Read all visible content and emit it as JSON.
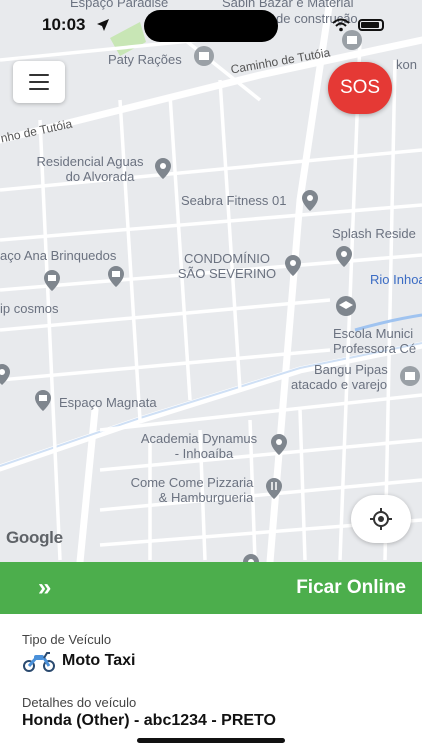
{
  "status_bar": {
    "time": "10:03"
  },
  "map": {
    "top_labels": {
      "espaco_paradise": "Espaço Paradise",
      "sabin_bazar": "Sabin Bazar e Material",
      "de_construcao": "de construção",
      "kon": "kon"
    },
    "streets": {
      "caminho_tutoia_top": "Caminho de Tutóia",
      "caminho_tutoia_left": "nho de Tutóia"
    },
    "pois": {
      "paty_racoes": "Paty Rações",
      "residencial_1": "Residencial Aguas",
      "residencial_2": "do Alvorada",
      "seabra": "Seabra Fitness 01",
      "splash": "Splash Reside",
      "ana_brinquedos": "aço Ana Brinquedos",
      "condominio_1": "CONDOMÍNIO",
      "condominio_2": "SÃO SEVERINO",
      "rio_inhoa": "Rio Inhoa",
      "ip_cosmos": "ip cosmos",
      "escola_1": "Escola Munici",
      "escola_2": "Professora Cé",
      "bangu_1": "Bangu Pipas",
      "bangu_2": "atacado e varejo",
      "espaco_magnata": "Espaço Magnata",
      "academia_1": "Academia Dynamus",
      "academia_2": "- Inhoaíba",
      "pizzaria_1": "Come Come Pizzaria",
      "pizzaria_2": "& Hamburgueria"
    },
    "google_logo": "Google"
  },
  "buttons": {
    "sos": "SOS"
  },
  "online_bar": {
    "arrows": "»",
    "label": "Ficar Online",
    "color": "#4cae4c"
  },
  "vehicle": {
    "type_label": "Tipo de Veículo",
    "type_value": "Moto Taxi",
    "details_label": "Detalhes do veículo",
    "details_value": "Honda (Other) - abc1234 - PRETO"
  },
  "icons": {
    "menu": "hamburger-icon",
    "locate": "crosshair-icon",
    "moto": "motorcycle-icon"
  }
}
